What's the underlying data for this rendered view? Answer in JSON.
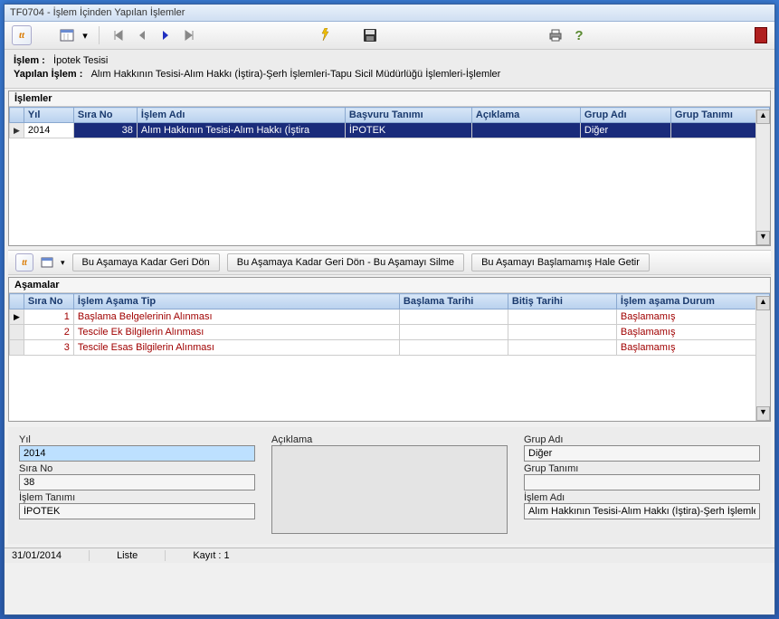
{
  "window": {
    "title": "TF0704 - İşlem İçinden Yapılan İşlemler"
  },
  "info": {
    "islem_label": "İşlem :",
    "islem_value": "İpotek Tesisi",
    "yapilan_label": "Yapılan İşlem :",
    "yapilan_value": "Alım Hakkının Tesisi-Alım Hakkı (İştira)-Şerh İşlemleri-Tapu Sicil Müdürlüğü İşlemleri-İşlemler"
  },
  "grid1": {
    "title": "İşlemler",
    "headers": {
      "yil": "Yıl",
      "sira": "Sıra No",
      "islem_adi": "İşlem Adı",
      "basvuru": "Başvuru Tanımı",
      "aciklama": "Açıklama",
      "grup_adi": "Grup Adı",
      "grup_tanimi": "Grup Tanımı"
    },
    "row": {
      "yil": "2014",
      "sira": "38",
      "islem_adi": "Alım Hakkının Tesisi-Alım Hakkı (İştira",
      "basvuru": "İPOTEK",
      "aciklama": "",
      "grup_adi": "Diğer",
      "grup_tanimi": ""
    }
  },
  "subtoolbar": {
    "btn1": "Bu Aşamaya Kadar Geri Dön",
    "btn2": "Bu Aşamaya Kadar Geri Dön - Bu Aşamayı Silme",
    "btn3": "Bu Aşamayı Başlamamış Hale Getir"
  },
  "grid2": {
    "title": "Aşamalar",
    "headers": {
      "sira": "Sıra No",
      "tip": "İşlem Aşama Tip",
      "baslama": "Başlama Tarihi",
      "bitis": "Bitiş Tarihi",
      "durum": "İşlem aşama Durum"
    },
    "rows": [
      {
        "sira": "1",
        "tip": "Başlama Belgelerinin Alınması",
        "baslama": "",
        "bitis": "",
        "durum": "Başlamamış"
      },
      {
        "sira": "2",
        "tip": "Tescile Ek Bilgilerin Alınması",
        "baslama": "",
        "bitis": "",
        "durum": "Başlamamış"
      },
      {
        "sira": "3",
        "tip": "Tescile Esas Bilgilerin Alınması",
        "baslama": "",
        "bitis": "",
        "durum": "Başlamamış"
      }
    ]
  },
  "form": {
    "yil_label": "Yıl",
    "yil": "2014",
    "sira_label": "Sıra No",
    "sira": "38",
    "islem_tanimi_label": "İşlem Tanımı",
    "islem_tanimi": "İPOTEK",
    "aciklama_label": "Açıklama",
    "aciklama": "",
    "grup_adi_label": "Grup Adı",
    "grup_adi": "Diğer",
    "grup_tanimi_label": "Grup Tanımı",
    "grup_tanimi": "",
    "islem_adi_label": "İşlem Adı",
    "islem_adi": "Alım Hakkının Tesisi-Alım Hakkı (İştira)-Şerh İşlemler"
  },
  "status": {
    "date": "31/01/2014",
    "mode": "Liste",
    "kayit": "Kayıt : 1"
  }
}
